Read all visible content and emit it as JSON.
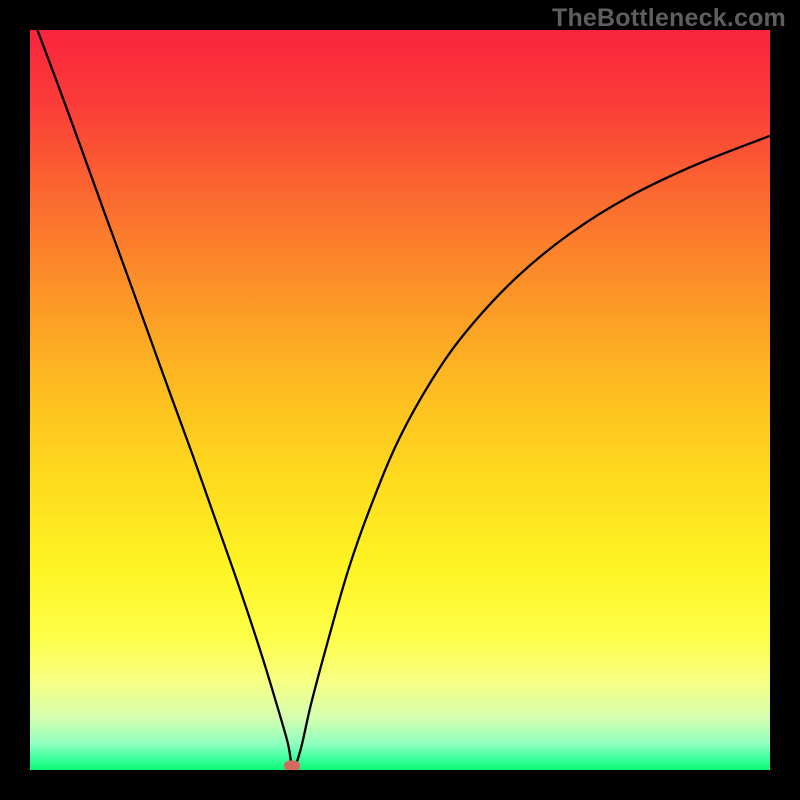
{
  "watermark": "TheBottleneck.com",
  "chart_data": {
    "type": "line",
    "title": "",
    "xlabel": "",
    "ylabel": "",
    "xlim": [
      0,
      100
    ],
    "ylim": [
      0,
      100
    ],
    "axes_visible": false,
    "background": {
      "type": "vertical_gradient",
      "stops": [
        {
          "pos": 0.0,
          "color": "#f9243d"
        },
        {
          "pos": 0.1,
          "color": "#fa3c38"
        },
        {
          "pos": 0.22,
          "color": "#fb6830"
        },
        {
          "pos": 0.35,
          "color": "#fc9328"
        },
        {
          "pos": 0.48,
          "color": "#fdbb21"
        },
        {
          "pos": 0.6,
          "color": "#fed91e"
        },
        {
          "pos": 0.72,
          "color": "#fef323"
        },
        {
          "pos": 0.82,
          "color": "#feff48"
        },
        {
          "pos": 0.88,
          "color": "#f7ff83"
        },
        {
          "pos": 0.93,
          "color": "#d4ffb0"
        },
        {
          "pos": 0.965,
          "color": "#8effbe"
        },
        {
          "pos": 0.985,
          "color": "#3aff9d"
        },
        {
          "pos": 1.0,
          "color": "#0ef776"
        }
      ]
    },
    "series": [
      {
        "name": "bottleneck_curve",
        "color": "#000000",
        "stroke_width": 2.3,
        "x": [
          1,
          4,
          7,
          10,
          13,
          16,
          19,
          22,
          25,
          28,
          31,
          33,
          34.8,
          35.5,
          36.5,
          38,
          40,
          43,
          46,
          50,
          55,
          60,
          66,
          73,
          81,
          90,
          100
        ],
        "y": [
          100,
          92,
          83.8,
          75.5,
          67.3,
          59,
          50.7,
          42.5,
          34,
          25.5,
          16.5,
          10,
          3.8,
          0.4,
          2.5,
          9,
          16.5,
          27,
          35.5,
          45,
          53.8,
          60.5,
          66.8,
          72.5,
          77.5,
          81.8,
          85.7
        ]
      }
    ],
    "marker": {
      "x": 35.4,
      "y": 0.6,
      "color": "#d46a5f"
    }
  }
}
